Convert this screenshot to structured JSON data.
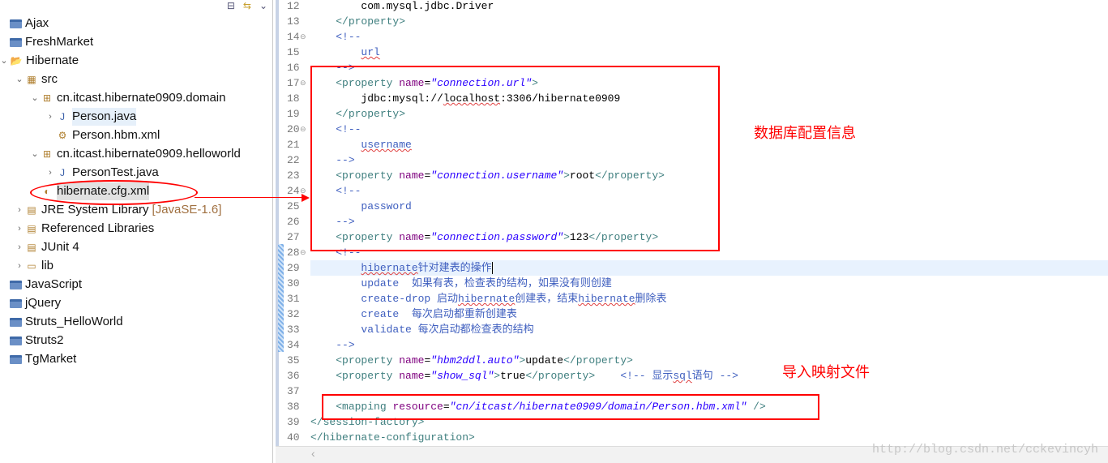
{
  "explorer": {
    "items": [
      {
        "label": "Ajax",
        "level": 0,
        "icon": "project-folder-icon"
      },
      {
        "label": "FreshMarket",
        "level": 0,
        "icon": "project-folder-icon"
      },
      {
        "label": "Hibernate",
        "level": 0,
        "icon": "open-project-icon",
        "expanded": true
      },
      {
        "label": "src",
        "level": 1,
        "icon": "source-folder-icon",
        "expanded": true
      },
      {
        "label": "cn.itcast.hibernate0909.domain",
        "level": 2,
        "icon": "package-icon",
        "expanded": true
      },
      {
        "label": "Person.java",
        "level": 3,
        "icon": "java-file-icon",
        "collapsed": true
      },
      {
        "label": "Person.hbm.xml",
        "level": 3,
        "icon": "hbm-xml-icon"
      },
      {
        "label": "cn.itcast.hibernate0909.helloworld",
        "level": 2,
        "icon": "package-icon",
        "expanded": true
      },
      {
        "label": "PersonTest.java",
        "level": 3,
        "icon": "java-file-icon",
        "collapsed": true
      },
      {
        "label": "hibernate.cfg.xml",
        "level": 2,
        "icon": "cfg-xml-icon",
        "selected": true
      },
      {
        "label": "JRE System Library",
        "suffix": "[JavaSE-1.6]",
        "level": 1,
        "icon": "library-icon",
        "collapsed": true
      },
      {
        "label": "Referenced Libraries",
        "level": 1,
        "icon": "library-icon",
        "collapsed": true
      },
      {
        "label": "JUnit 4",
        "level": 1,
        "icon": "library-icon",
        "collapsed": true
      },
      {
        "label": "lib",
        "level": 1,
        "icon": "folder-icon",
        "collapsed": true
      },
      {
        "label": "JavaScript",
        "level": 0,
        "icon": "project-folder-icon"
      },
      {
        "label": "jQuery",
        "level": 0,
        "icon": "project-folder-icon"
      },
      {
        "label": "Struts_HelloWorld",
        "level": 0,
        "icon": "project-folder-icon"
      },
      {
        "label": "Struts2",
        "level": 0,
        "icon": "project-folder-icon"
      },
      {
        "label": "TgMarket",
        "level": 0,
        "icon": "project-folder-icon"
      }
    ]
  },
  "editor": {
    "lines": [
      {
        "n": "12",
        "parts": [
          [
            "",
            "        "
          ],
          [
            "txt",
            "com.mysql.jdbc.Driver"
          ]
        ]
      },
      {
        "n": "13",
        "parts": [
          [
            "",
            "    "
          ],
          [
            "tag",
            "</property>"
          ]
        ]
      },
      {
        "n": "14",
        "fold": true,
        "parts": [
          [
            "",
            "    "
          ],
          [
            "com",
            "<!--"
          ]
        ]
      },
      {
        "n": "15",
        "parts": [
          [
            "",
            "        "
          ],
          [
            "com sq",
            "url"
          ]
        ]
      },
      {
        "n": "16",
        "parts": [
          [
            "",
            "    "
          ],
          [
            "com",
            "-->"
          ]
        ]
      },
      {
        "n": "17",
        "fold": true,
        "parts": [
          [
            "",
            "    "
          ],
          [
            "tag",
            "<property "
          ],
          [
            "att",
            "name"
          ],
          [
            "txt",
            "="
          ],
          [
            "val",
            "\"connection.url\""
          ],
          [
            "tag",
            ">"
          ]
        ]
      },
      {
        "n": "18",
        "parts": [
          [
            "",
            "        "
          ],
          [
            "txt",
            "jdbc:mysql://"
          ],
          [
            "txt sq",
            "localhost"
          ],
          [
            "txt",
            ":3306/hibernate0909"
          ]
        ]
      },
      {
        "n": "19",
        "parts": [
          [
            "",
            "    "
          ],
          [
            "tag",
            "</property>"
          ]
        ]
      },
      {
        "n": "20",
        "fold": true,
        "parts": [
          [
            "",
            "    "
          ],
          [
            "com",
            "<!--"
          ]
        ]
      },
      {
        "n": "21",
        "parts": [
          [
            "",
            "        "
          ],
          [
            "com sq",
            "username"
          ]
        ]
      },
      {
        "n": "22",
        "parts": [
          [
            "",
            "    "
          ],
          [
            "com",
            "-->"
          ]
        ]
      },
      {
        "n": "23",
        "parts": [
          [
            "",
            "    "
          ],
          [
            "tag",
            "<property "
          ],
          [
            "att",
            "name"
          ],
          [
            "txt",
            "="
          ],
          [
            "val",
            "\"connection.username\""
          ],
          [
            "tag",
            ">"
          ],
          [
            "txt",
            "root"
          ],
          [
            "tag",
            "</property>"
          ]
        ]
      },
      {
        "n": "24",
        "fold": true,
        "parts": [
          [
            "",
            "    "
          ],
          [
            "com",
            "<!--"
          ]
        ]
      },
      {
        "n": "25",
        "parts": [
          [
            "",
            "        "
          ],
          [
            "com",
            "password"
          ]
        ]
      },
      {
        "n": "26",
        "parts": [
          [
            "",
            "    "
          ],
          [
            "com",
            "-->"
          ]
        ]
      },
      {
        "n": "27",
        "parts": [
          [
            "",
            "    "
          ],
          [
            "tag",
            "<property "
          ],
          [
            "att",
            "name"
          ],
          [
            "txt",
            "="
          ],
          [
            "val",
            "\"connection.password\""
          ],
          [
            "tag",
            ">"
          ],
          [
            "txt",
            "123"
          ],
          [
            "tag",
            "</property>"
          ]
        ]
      },
      {
        "n": "28",
        "fold": true,
        "parts": [
          [
            "",
            "    "
          ],
          [
            "com",
            "<!--"
          ]
        ]
      },
      {
        "n": "29",
        "current": true,
        "parts": [
          [
            "",
            "        "
          ],
          [
            "com sq",
            "hibernate"
          ],
          [
            "com",
            "针对建表的操作"
          ]
        ]
      },
      {
        "n": "30",
        "parts": [
          [
            "",
            "        "
          ],
          [
            "com",
            "update  如果有表，检查表的结构，如果没有则创建"
          ]
        ]
      },
      {
        "n": "31",
        "parts": [
          [
            "",
            "        "
          ],
          [
            "com",
            "create-drop 启动"
          ],
          [
            "com sq",
            "hibernate"
          ],
          [
            "com",
            "创建表，结束"
          ],
          [
            "com sq",
            "hibernate"
          ],
          [
            "com",
            "删除表"
          ]
        ]
      },
      {
        "n": "32",
        "parts": [
          [
            "",
            "        "
          ],
          [
            "com",
            "create  每次启动都重新创建表"
          ]
        ]
      },
      {
        "n": "33",
        "parts": [
          [
            "",
            "        "
          ],
          [
            "com",
            "validate 每次启动都检查表的结构"
          ]
        ]
      },
      {
        "n": "34",
        "parts": [
          [
            "",
            "    "
          ],
          [
            "com",
            "-->"
          ]
        ]
      },
      {
        "n": "35",
        "parts": [
          [
            "",
            "    "
          ],
          [
            "tag",
            "<property "
          ],
          [
            "att",
            "name"
          ],
          [
            "txt",
            "="
          ],
          [
            "val",
            "\"hbm2ddl.auto\""
          ],
          [
            "tag",
            ">"
          ],
          [
            "txt",
            "update"
          ],
          [
            "tag",
            "</property>"
          ]
        ]
      },
      {
        "n": "36",
        "parts": [
          [
            "",
            "    "
          ],
          [
            "tag",
            "<property "
          ],
          [
            "att",
            "name"
          ],
          [
            "txt",
            "="
          ],
          [
            "val",
            "\"show_sql\""
          ],
          [
            "tag",
            ">"
          ],
          [
            "txt",
            "true"
          ],
          [
            "tag",
            "</property>"
          ],
          [
            "",
            "    "
          ],
          [
            "com",
            "<!-- 显示"
          ],
          [
            "com sq",
            "sql"
          ],
          [
            "com",
            "语句 -->"
          ]
        ]
      },
      {
        "n": "37",
        "parts": []
      },
      {
        "n": "38",
        "parts": [
          [
            "",
            "    "
          ],
          [
            "tag",
            "<mapping "
          ],
          [
            "att",
            "resource"
          ],
          [
            "txt",
            "="
          ],
          [
            "val",
            "\"cn/itcast/hibernate0909/domain/Person.hbm.xml\""
          ],
          [
            "txt",
            " "
          ],
          [
            "tag",
            "/>"
          ]
        ]
      },
      {
        "n": "39",
        "parts": [
          [
            "tag",
            "</session-factory>"
          ]
        ]
      },
      {
        "n": "40",
        "parts": [
          [
            "tag",
            "</hibernate-configuration>"
          ]
        ]
      }
    ]
  },
  "annotations": {
    "db_config": "数据库配置信息",
    "import_mapping": "导入映射文件",
    "color": "#ff0000"
  },
  "watermark": "http://blog.csdn.net/cckevincyh"
}
